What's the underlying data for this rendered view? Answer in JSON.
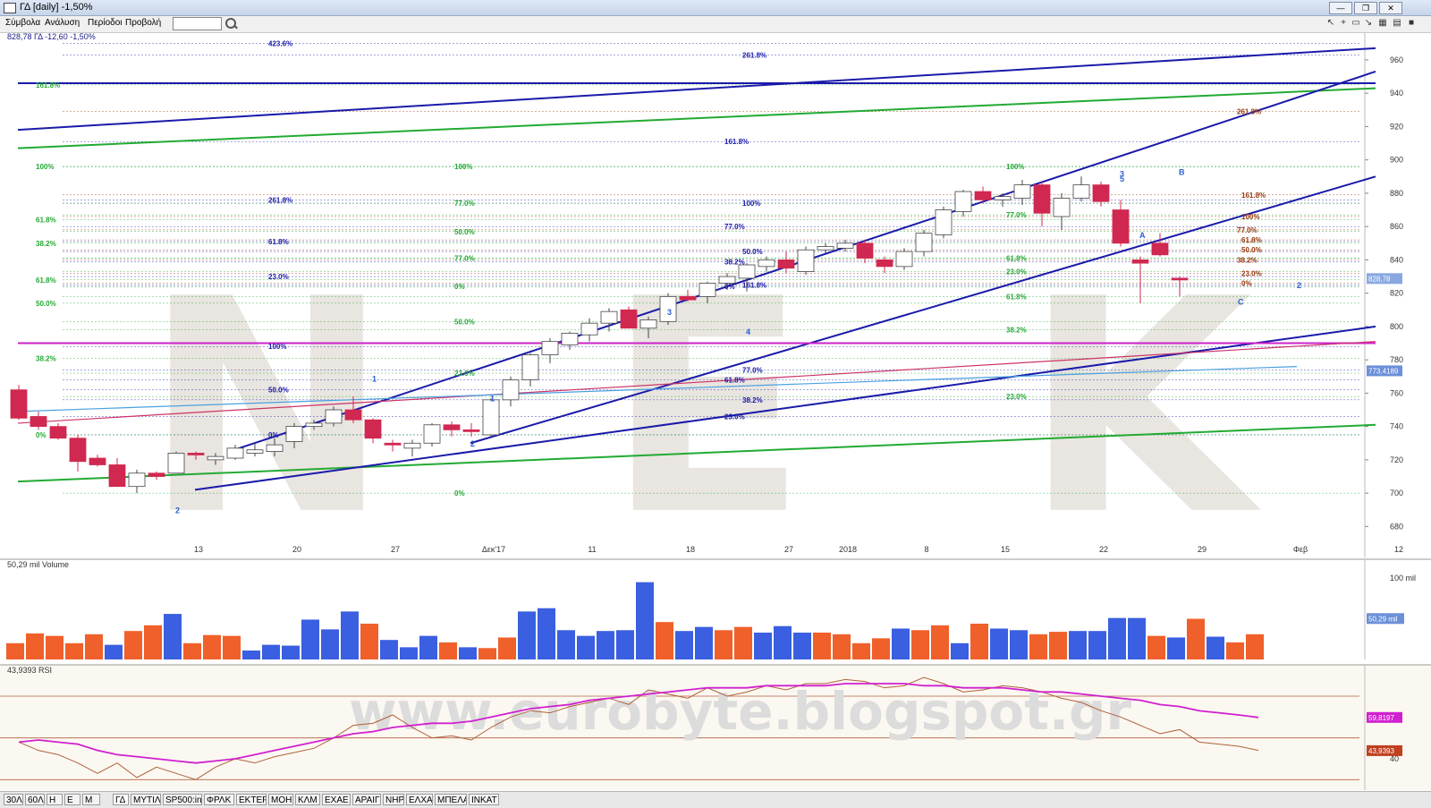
{
  "window": {
    "title": "ΓΔ [daily] -1,50%"
  },
  "menu": {
    "items": [
      "Σύμβολα",
      "Ανάλυση",
      "Περίοδοι",
      "Προβολή"
    ]
  },
  "tabs": [
    "30Λ",
    "60Λ",
    "H",
    "E",
    "M",
    "ΓΔ",
    "ΜΥΤΙΛ",
    "SP500:ind",
    "ΦΡΛΚ",
    "ΕΚΤΕΡ",
    "ΜΟΗ",
    "ΚΛΜ",
    "ΕΧΑΕ",
    "ΑΡΑΙΓ",
    "ΝΗΡ",
    "ΕΛΧΑ",
    "ΜΠΕΛΑ",
    "ΙΝΚΑΤ"
  ],
  "active_tab": "ΓΔ",
  "colors": {
    "up": "#ffffff",
    "down": "#d02850",
    "blue_line": "#1a1aaa",
    "green_line": "#22aa33",
    "magenta": "#cc22cc",
    "vol_blue": "#3a5fe0",
    "vol_orange": "#f0602a",
    "rsi_brown": "#b0603a",
    "rsi_magenta": "#d020d0"
  },
  "watermark": {
    "main": "NEK",
    "bottom": "www.eurobyte.blogspot.gr"
  },
  "chart_data": [
    {
      "type": "candlestick",
      "header": "828,78 ΓΔ -12,60 -1,50%",
      "x_tick_labels": [
        "13",
        "20",
        "27",
        "Δεκ'17",
        "11",
        "18",
        "27",
        "2018",
        "8",
        "15",
        "22",
        "29",
        "Φεβ",
        "12"
      ],
      "x_tick_index": [
        5,
        10,
        15,
        20,
        25,
        30,
        35,
        38,
        42,
        46,
        51,
        56,
        61,
        66
      ],
      "ylim": [
        670,
        975
      ],
      "y_ticks": [
        680,
        700,
        720,
        740,
        760,
        780,
        800,
        820,
        840,
        860,
        880,
        900,
        920,
        940,
        960
      ],
      "price_labels": [
        {
          "text": "828,78",
          "value": 828.78
        },
        {
          "text": "773,4189",
          "value": 773.4189
        }
      ],
      "ohlc": [
        [
          762,
          765,
          744,
          745
        ],
        [
          746,
          749,
          738,
          740
        ],
        [
          740,
          742,
          732,
          733
        ],
        [
          733,
          735,
          713,
          719
        ],
        [
          721,
          723,
          716,
          717
        ],
        [
          717,
          721,
          705,
          704
        ],
        [
          704,
          714,
          700,
          712
        ],
        [
          712,
          713,
          708,
          710
        ],
        [
          712,
          725,
          712,
          724
        ],
        [
          724,
          725,
          720,
          723
        ],
        [
          720,
          724,
          717,
          722
        ],
        [
          721,
          729,
          720,
          727
        ],
        [
          724,
          730,
          722,
          726
        ],
        [
          725,
          733,
          722,
          729
        ],
        [
          731,
          742,
          727,
          740
        ],
        [
          740,
          744,
          738,
          742
        ],
        [
          742,
          752,
          740,
          750
        ],
        [
          750,
          758,
          742,
          744
        ],
        [
          744,
          745,
          730,
          733
        ],
        [
          730,
          732,
          725,
          729
        ],
        [
          727,
          732,
          722,
          730
        ],
        [
          730,
          742,
          728,
          741
        ],
        [
          741,
          743,
          734,
          738
        ],
        [
          738,
          742,
          734,
          737
        ],
        [
          735,
          757,
          734,
          756
        ],
        [
          756,
          770,
          752,
          768
        ],
        [
          768,
          784,
          764,
          783
        ],
        [
          783,
          793,
          778,
          791
        ],
        [
          789,
          797,
          786,
          796
        ],
        [
          795,
          805,
          791,
          802
        ],
        [
          802,
          811,
          797,
          809
        ],
        [
          810,
          812,
          800,
          799
        ],
        [
          799,
          806,
          793,
          804
        ],
        [
          803,
          820,
          801,
          818
        ],
        [
          818,
          822,
          815,
          816
        ],
        [
          818,
          827,
          814,
          826
        ],
        [
          826,
          832,
          822,
          830
        ],
        [
          829,
          838,
          821,
          837
        ],
        [
          836,
          842,
          833,
          840
        ],
        [
          840,
          845,
          832,
          835
        ],
        [
          833,
          848,
          831,
          846
        ],
        [
          846,
          850,
          844,
          848
        ],
        [
          847,
          852,
          845,
          850
        ],
        [
          850,
          852,
          838,
          841
        ],
        [
          840,
          842,
          832,
          836
        ],
        [
          836,
          847,
          834,
          845
        ],
        [
          845,
          858,
          842,
          856
        ],
        [
          855,
          872,
          853,
          870
        ],
        [
          869,
          882,
          866,
          881
        ],
        [
          881,
          884,
          874,
          876
        ],
        [
          876,
          880,
          872,
          878
        ],
        [
          877,
          888,
          873,
          885
        ],
        [
          885,
          887,
          860,
          868
        ],
        [
          866,
          880,
          858,
          877
        ],
        [
          877,
          890,
          875,
          885
        ],
        [
          885,
          887,
          872,
          875
        ],
        [
          870,
          876,
          848,
          850
        ],
        [
          840,
          842,
          814,
          838
        ],
        [
          850,
          856,
          842,
          843
        ],
        [
          829,
          830,
          818,
          828.78
        ]
      ],
      "fib_labels": [
        {
          "text": "423.6%",
          "value": 970,
          "color": "blue"
        },
        {
          "text": "261.8%",
          "value": 963,
          "color": "blue"
        },
        {
          "text": "161.8%",
          "value": 945,
          "color": "green"
        },
        {
          "text": "261.8%",
          "value": 929,
          "color": "brown"
        },
        {
          "text": "161.8%",
          "value": 911,
          "color": "blue"
        },
        {
          "text": "100%",
          "value": 896,
          "color": "green"
        },
        {
          "text": "100%",
          "value": 896,
          "color": "green"
        },
        {
          "text": "100%",
          "value": 896,
          "color": "green"
        },
        {
          "text": "161.8%",
          "value": 879,
          "color": "brown"
        },
        {
          "text": "261.8%",
          "value": 876,
          "color": "blue"
        },
        {
          "text": "100%",
          "value": 874,
          "color": "blue"
        },
        {
          "text": "77.0%",
          "value": 874,
          "color": "green"
        },
        {
          "text": "77.0%",
          "value": 867,
          "color": "green"
        },
        {
          "text": "100%",
          "value": 866,
          "color": "brown"
        },
        {
          "text": "61.8%",
          "value": 864,
          "color": "green"
        },
        {
          "text": "77.0%",
          "value": 860,
          "color": "blue"
        },
        {
          "text": "77.0%",
          "value": 858,
          "color": "brown"
        },
        {
          "text": "50.0%",
          "value": 857,
          "color": "green"
        },
        {
          "text": "61.8%",
          "value": 851,
          "color": "blue"
        },
        {
          "text": "61.8%",
          "value": 852,
          "color": "brown"
        },
        {
          "text": "61.8%",
          "value": 841,
          "color": "green"
        },
        {
          "text": "38.2%",
          "value": 850,
          "color": "green"
        },
        {
          "text": "50.0%",
          "value": 845,
          "color": "blue"
        },
        {
          "text": "50.0%",
          "value": 846,
          "color": "brown"
        },
        {
          "text": "38.2%",
          "value": 839,
          "color": "blue"
        },
        {
          "text": "38.2%",
          "value": 840,
          "color": "brown"
        },
        {
          "text": "77.0%",
          "value": 841,
          "color": "green"
        },
        {
          "text": "23.0%",
          "value": 830,
          "color": "blue"
        },
        {
          "text": "23.0%",
          "value": 833,
          "color": "green"
        },
        {
          "text": "23.0%",
          "value": 832,
          "color": "brown"
        },
        {
          "text": "61.8%",
          "value": 828,
          "color": "green"
        },
        {
          "text": "161.8%",
          "value": 825,
          "color": "blue"
        },
        {
          "text": "0%",
          "value": 824,
          "color": "blue"
        },
        {
          "text": "0%",
          "value": 824,
          "color": "green"
        },
        {
          "text": "0%",
          "value": 826,
          "color": "brown"
        },
        {
          "text": "61.8%",
          "value": 818,
          "color": "green"
        },
        {
          "text": "50.0%",
          "value": 814,
          "color": "green"
        },
        {
          "text": "50.0%",
          "value": 803,
          "color": "green"
        },
        {
          "text": "38.2%",
          "value": 798,
          "color": "green"
        },
        {
          "text": "100%",
          "value": 788,
          "color": "blue"
        },
        {
          "text": "38.2%",
          "value": 781,
          "color": "green"
        },
        {
          "text": "77.0%",
          "value": 774,
          "color": "blue"
        },
        {
          "text": "23.0%",
          "value": 772,
          "color": "green"
        },
        {
          "text": "61.8%",
          "value": 768,
          "color": "blue"
        },
        {
          "text": "50.0%",
          "value": 762,
          "color": "blue"
        },
        {
          "text": "23.0%",
          "value": 758,
          "color": "green"
        },
        {
          "text": "38.2%",
          "value": 756,
          "color": "blue"
        },
        {
          "text": "23.0%",
          "value": 746,
          "color": "blue"
        },
        {
          "text": "0%",
          "value": 735,
          "color": "blue"
        },
        {
          "text": "0%",
          "value": 735,
          "color": "green"
        },
        {
          "text": "0%",
          "value": 700,
          "color": "green"
        }
      ],
      "wave_labels": [
        {
          "text": "1",
          "i": 18,
          "value": 767
        },
        {
          "text": "2",
          "i": 23,
          "value": 728
        },
        {
          "text": "1",
          "i": 24,
          "value": 755
        },
        {
          "text": "3",
          "i": 33,
          "value": 807
        },
        {
          "text": "4",
          "i": 37,
          "value": 795
        },
        {
          "text": "2",
          "i": 8,
          "value": 688
        },
        {
          "text": "3",
          "i": 56,
          "value": 890
        },
        {
          "text": "5",
          "i": 56,
          "value": 887
        },
        {
          "text": "B",
          "i": 59,
          "value": 891
        },
        {
          "text": "A",
          "i": 57,
          "value": 853
        },
        {
          "text": "C",
          "i": 62,
          "value": 813
        },
        {
          "text": "2",
          "i": 65,
          "value": 823
        }
      ],
      "trendlines": [
        {
          "color": "blue",
          "from": [
            0,
            946
          ],
          "to": [
            69,
            946
          ]
        },
        {
          "color": "blue",
          "from": [
            0,
            918
          ],
          "to": [
            69,
            967
          ]
        },
        {
          "color": "green",
          "from": [
            0,
            907
          ],
          "to": [
            69,
            943
          ]
        },
        {
          "color": "blue",
          "from": [
            11,
            726
          ],
          "to": [
            69,
            953
          ]
        },
        {
          "color": "blue",
          "from": [
            23,
            730
          ],
          "to": [
            69,
            890
          ]
        },
        {
          "color": "green",
          "from": [
            0,
            707
          ],
          "to": [
            69,
            741
          ]
        },
        {
          "color": "blue",
          "from": [
            9,
            702
          ],
          "to": [
            69,
            800
          ]
        },
        {
          "color": "magenta",
          "from": [
            0,
            790
          ],
          "to": [
            69,
            790
          ]
        },
        {
          "color": "pink",
          "from": [
            0,
            742
          ],
          "to": [
            69,
            791
          ]
        },
        {
          "color": "lightblue",
          "from": [
            0,
            749
          ],
          "to": [
            65,
            776
          ]
        }
      ]
    },
    {
      "type": "bar",
      "title": "50,29 mil Volume",
      "y_tick_labels": [
        "100 mil"
      ],
      "price_labels": [
        "50,29 mil"
      ],
      "values": [
        20,
        32,
        29,
        20,
        31,
        18,
        35,
        42,
        56,
        20,
        30,
        29,
        11,
        18,
        17,
        49,
        37,
        59,
        44,
        24,
        15,
        29,
        21,
        15,
        14,
        27,
        59,
        63,
        36,
        29,
        35,
        36,
        95,
        46,
        35,
        40,
        36,
        40,
        33,
        41,
        33,
        33,
        31,
        20,
        26,
        38,
        36,
        42,
        20,
        44,
        38,
        36,
        31,
        34,
        35,
        35,
        51,
        51,
        29,
        27,
        50,
        28,
        21,
        31
      ],
      "colors": [
        "o",
        "o",
        "o",
        "o",
        "o",
        "b",
        "o",
        "o",
        "b",
        "o",
        "o",
        "o",
        "b",
        "b",
        "b",
        "b",
        "b",
        "b",
        "o",
        "b",
        "b",
        "b",
        "o",
        "b",
        "o",
        "o",
        "b",
        "b",
        "b",
        "b",
        "b",
        "b",
        "b",
        "o",
        "b",
        "b",
        "o",
        "o",
        "b",
        "b",
        "b",
        "o",
        "o",
        "o",
        "o",
        "b",
        "o",
        "o",
        "b",
        "o",
        "b",
        "b",
        "o",
        "o",
        "b",
        "b",
        "b",
        "b",
        "o",
        "b",
        "o",
        "b",
        "o",
        "o"
      ]
    },
    {
      "type": "line",
      "title": "43,9393 RSI",
      "y_tick_labels": [
        "40"
      ],
      "price_labels": [
        "59,8197",
        "43,9393"
      ],
      "series": [
        {
          "color": "brown",
          "values": [
            48,
            44,
            42,
            38,
            33,
            38,
            31,
            36,
            33,
            30,
            36,
            40,
            38,
            41,
            43,
            45,
            50,
            56,
            57,
            61,
            55,
            50,
            51,
            49,
            55,
            60,
            63,
            62,
            65,
            67,
            69,
            66,
            73,
            71,
            69,
            74,
            70,
            72,
            75,
            73,
            76,
            76,
            78,
            77,
            74,
            75,
            79,
            76,
            72,
            73,
            75,
            74,
            72,
            69,
            67,
            63,
            60,
            56,
            52,
            54,
            48,
            47,
            46,
            44
          ]
        },
        {
          "color": "magenta",
          "values": [
            48,
            49,
            48,
            47,
            44,
            42,
            41,
            40,
            39,
            38,
            39,
            40,
            42,
            44,
            46,
            48,
            50,
            52,
            53,
            55,
            56,
            57,
            57,
            58,
            60,
            62,
            64,
            65,
            66,
            68,
            69,
            70,
            71,
            72,
            73,
            74,
            74,
            74,
            75,
            75,
            75,
            75,
            76,
            76,
            76,
            76,
            75,
            75,
            74,
            74,
            74,
            73,
            72,
            72,
            71,
            70,
            69,
            68,
            66,
            65,
            63,
            62,
            61,
            59.8
          ]
        }
      ]
    }
  ]
}
